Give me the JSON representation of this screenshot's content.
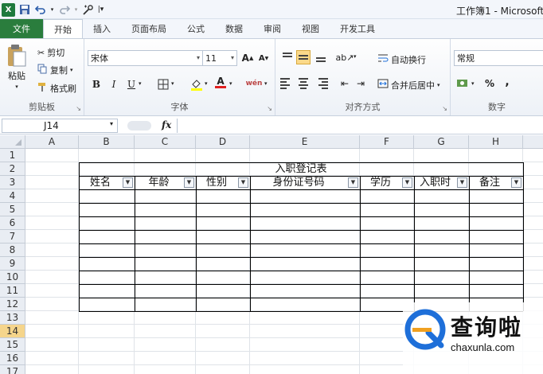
{
  "window": {
    "title": "工作簿1 - Microsoft"
  },
  "tabs": [
    {
      "label": "文件"
    },
    {
      "label": "开始"
    },
    {
      "label": "插入"
    },
    {
      "label": "页面布局"
    },
    {
      "label": "公式"
    },
    {
      "label": "数据"
    },
    {
      "label": "审阅"
    },
    {
      "label": "视图"
    },
    {
      "label": "开发工具"
    }
  ],
  "clipboard": {
    "paste": "粘贴",
    "cut": "剪切",
    "copy": "复制",
    "format_painter": "格式刷",
    "label": "剪贴板"
  },
  "font": {
    "name": "宋体",
    "size": "11",
    "label": "字体",
    "bold": "B",
    "italic": "I",
    "underline": "U"
  },
  "alignment": {
    "wrap": "自动换行",
    "merge": "合并后居中",
    "label": "对齐方式"
  },
  "number": {
    "format": "常规",
    "percent": "%",
    "comma": ",",
    "label": "数字"
  },
  "formula_bar": {
    "name_box": "J14",
    "fx": "fx",
    "value": ""
  },
  "columns": [
    "A",
    "B",
    "C",
    "D",
    "E",
    "F",
    "G",
    "H"
  ],
  "rows": [
    "1",
    "2",
    "3",
    "4",
    "5",
    "6",
    "7",
    "8",
    "9",
    "10",
    "11",
    "12",
    "13",
    "14",
    "15",
    "16",
    "17"
  ],
  "selected_row": "14",
  "table": {
    "title": "入职登记表",
    "headers": [
      "姓名",
      "年龄",
      "性别",
      "身份证号码",
      "学历",
      "入职时",
      "备注"
    ]
  },
  "watermark": {
    "text_cn": "查询啦",
    "text_en": "chaxunla.com"
  },
  "colors": {
    "file_tab": "#2a7d3d",
    "accent_blue": "#1e6fd9",
    "selected_row": "#f5d58b"
  }
}
